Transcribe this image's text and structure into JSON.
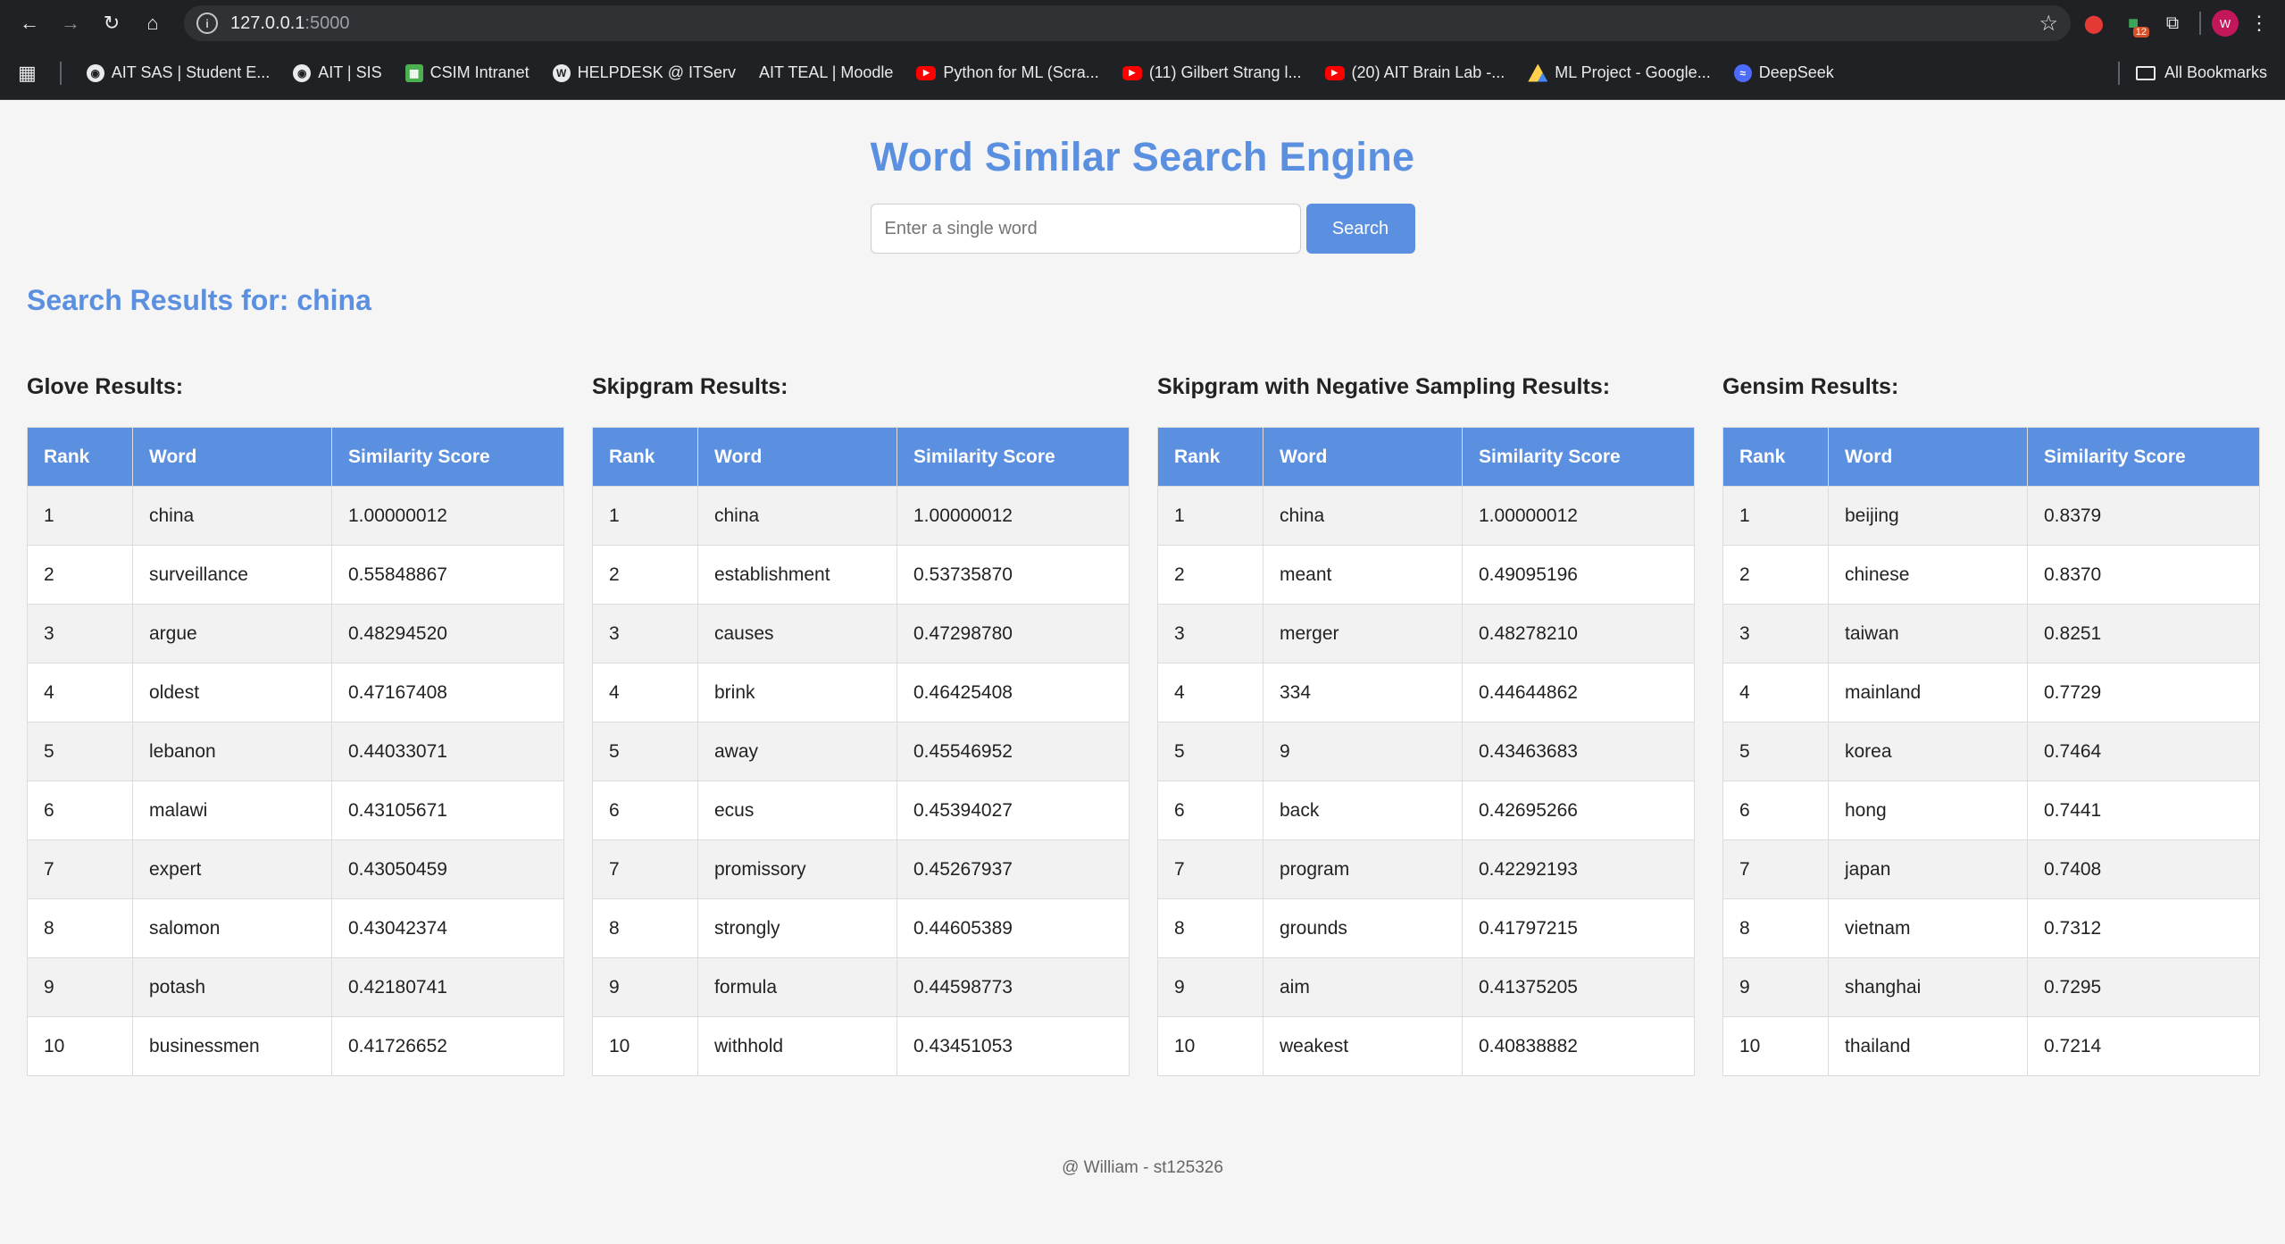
{
  "browser": {
    "url_host": "127.0.0.1",
    "url_port": ":5000",
    "bookmarks": [
      {
        "label": "AIT SAS | Student E...",
        "icon": "globe-icon"
      },
      {
        "label": "AIT | SIS",
        "icon": "globe-icon"
      },
      {
        "label": "CSIM Intranet",
        "icon": "csim-icon"
      },
      {
        "label": "HELPDESK @ ITServ",
        "icon": "wordpress-icon"
      },
      {
        "label": "AIT TEAL | Moodle",
        "icon": "none"
      },
      {
        "label": "Python for ML (Scra...",
        "icon": "youtube-icon"
      },
      {
        "label": "(11) Gilbert Strang l...",
        "icon": "youtube-icon"
      },
      {
        "label": "(20) AIT Brain Lab -...",
        "icon": "youtube-icon"
      },
      {
        "label": "ML Project - Google...",
        "icon": "drive-icon"
      },
      {
        "label": "DeepSeek",
        "icon": "deepseek-icon"
      }
    ],
    "all_bookmarks": "All Bookmarks",
    "ext_badge": "12",
    "avatar": "W"
  },
  "page": {
    "title": "Word Similar Search Engine",
    "search_placeholder": "Enter a single word",
    "search_button": "Search",
    "results_heading": "Search Results for: china",
    "footer": "@ William - st125326"
  },
  "columns": [
    "Rank",
    "Word",
    "Similarity Score"
  ],
  "models": [
    {
      "title": "Glove Results:",
      "rows": [
        [
          "1",
          "china",
          "1.00000012"
        ],
        [
          "2",
          "surveillance",
          "0.55848867"
        ],
        [
          "3",
          "argue",
          "0.48294520"
        ],
        [
          "4",
          "oldest",
          "0.47167408"
        ],
        [
          "5",
          "lebanon",
          "0.44033071"
        ],
        [
          "6",
          "malawi",
          "0.43105671"
        ],
        [
          "7",
          "expert",
          "0.43050459"
        ],
        [
          "8",
          "salomon",
          "0.43042374"
        ],
        [
          "9",
          "potash",
          "0.42180741"
        ],
        [
          "10",
          "businessmen",
          "0.41726652"
        ]
      ]
    },
    {
      "title": "Skipgram Results:",
      "rows": [
        [
          "1",
          "china",
          "1.00000012"
        ],
        [
          "2",
          "establishment",
          "0.53735870"
        ],
        [
          "3",
          "causes",
          "0.47298780"
        ],
        [
          "4",
          "brink",
          "0.46425408"
        ],
        [
          "5",
          "away",
          "0.45546952"
        ],
        [
          "6",
          "ecus",
          "0.45394027"
        ],
        [
          "7",
          "promissory",
          "0.45267937"
        ],
        [
          "8",
          "strongly",
          "0.44605389"
        ],
        [
          "9",
          "formula",
          "0.44598773"
        ],
        [
          "10",
          "withhold",
          "0.43451053"
        ]
      ]
    },
    {
      "title": "Skipgram with Negative Sampling Results:",
      "rows": [
        [
          "1",
          "china",
          "1.00000012"
        ],
        [
          "2",
          "meant",
          "0.49095196"
        ],
        [
          "3",
          "merger",
          "0.48278210"
        ],
        [
          "4",
          "334",
          "0.44644862"
        ],
        [
          "5",
          "9",
          "0.43463683"
        ],
        [
          "6",
          "back",
          "0.42695266"
        ],
        [
          "7",
          "program",
          "0.42292193"
        ],
        [
          "8",
          "grounds",
          "0.41797215"
        ],
        [
          "9",
          "aim",
          "0.41375205"
        ],
        [
          "10",
          "weakest",
          "0.40838882"
        ]
      ]
    },
    {
      "title": "Gensim Results:",
      "rows": [
        [
          "1",
          "beijing",
          "0.8379"
        ],
        [
          "2",
          "chinese",
          "0.8370"
        ],
        [
          "3",
          "taiwan",
          "0.8251"
        ],
        [
          "4",
          "mainland",
          "0.7729"
        ],
        [
          "5",
          "korea",
          "0.7464"
        ],
        [
          "6",
          "hong",
          "0.7441"
        ],
        [
          "7",
          "japan",
          "0.7408"
        ],
        [
          "8",
          "vietnam",
          "0.7312"
        ],
        [
          "9",
          "shanghai",
          "0.7295"
        ],
        [
          "10",
          "thailand",
          "0.7214"
        ]
      ]
    }
  ]
}
